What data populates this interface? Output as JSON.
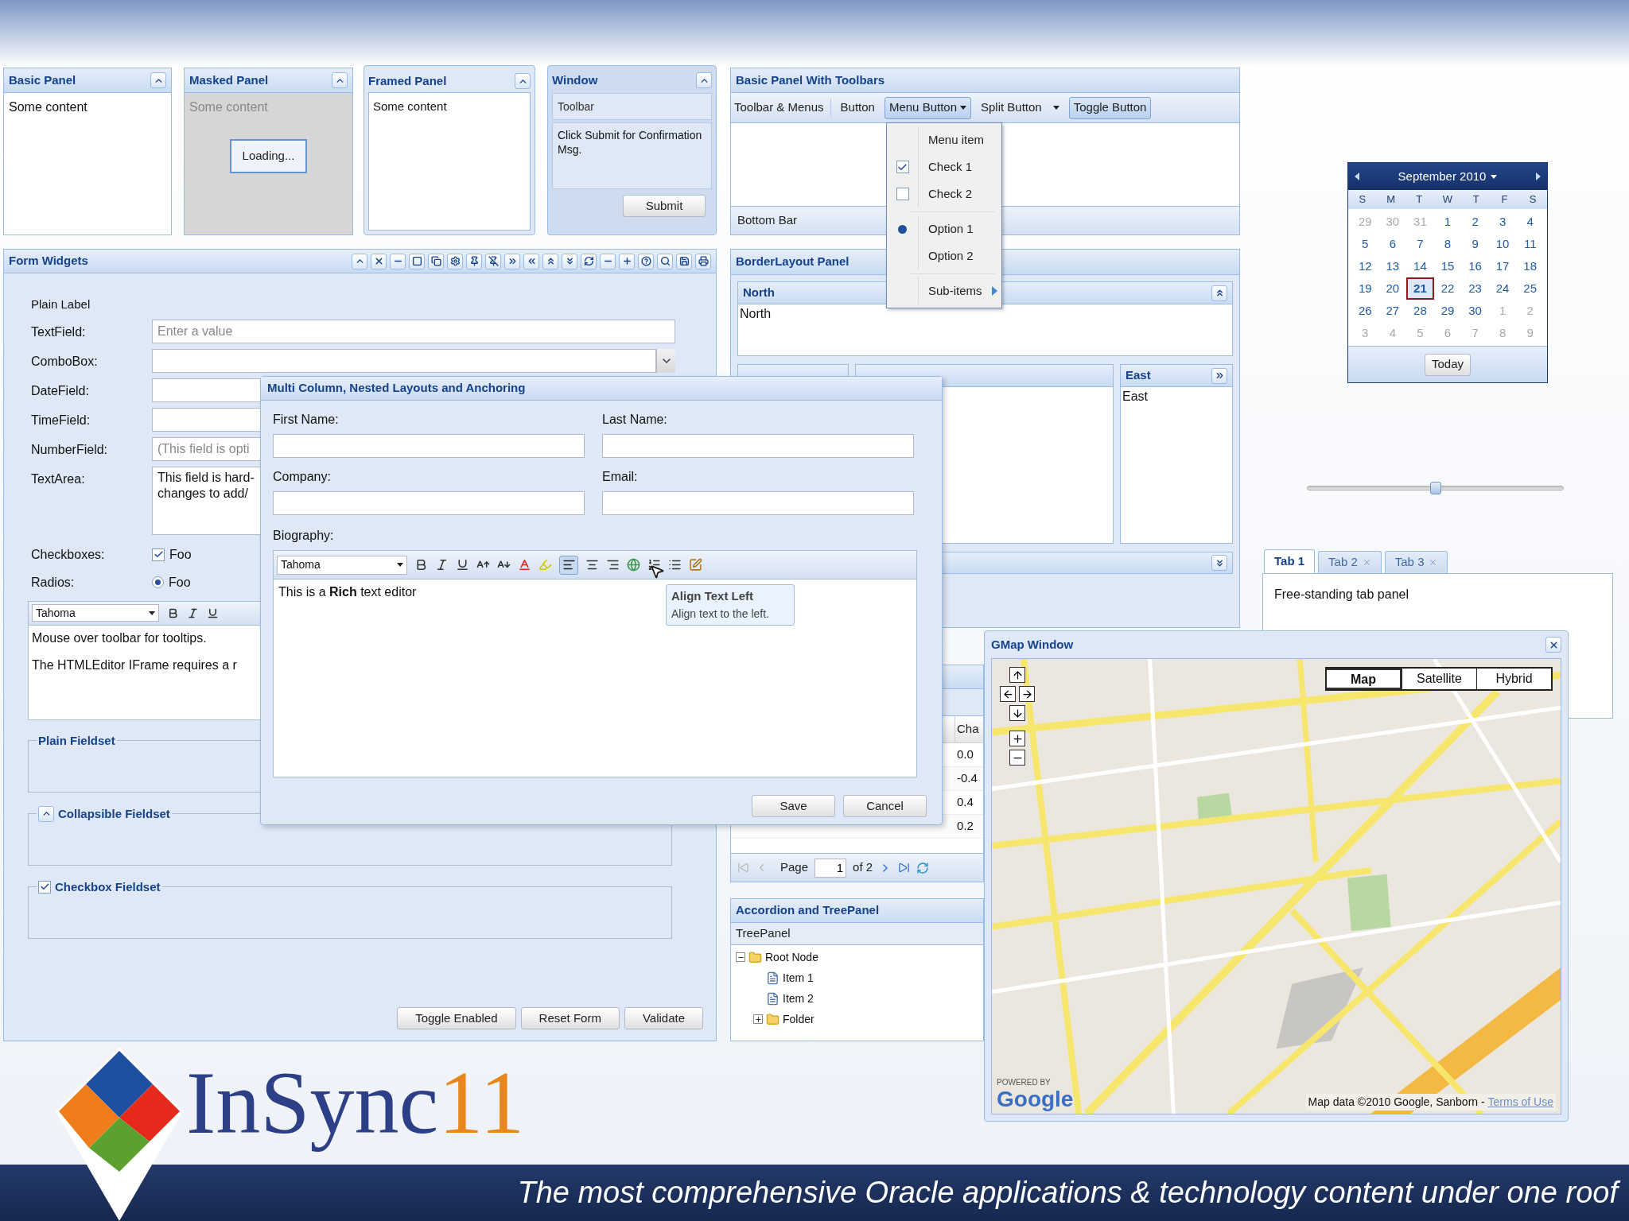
{
  "basic_panel": {
    "title": "Basic Panel",
    "content": "Some content"
  },
  "masked_panel": {
    "title": "Masked Panel",
    "content": "Some content",
    "masked": true,
    "mask_message": "Loading..."
  },
  "framed_panel": {
    "title": "Framed Panel",
    "content": "Some content"
  },
  "window_panel": {
    "title": "Window",
    "toolbar": "Toolbar",
    "content": "Click Submit for Confirmation Msg.",
    "button": "Submit"
  },
  "toolbar_panel": {
    "title": "Basic Panel With Toolbars",
    "toolbar": [
      {
        "kind": "text",
        "label": "Toolbar & Menus"
      },
      {
        "kind": "button",
        "label": "Button",
        "pressed": false
      },
      {
        "kind": "menu",
        "label": "Menu Button",
        "pressed": true
      },
      {
        "kind": "split",
        "label": "Split Button",
        "pressed": false
      },
      {
        "kind": "button",
        "label": "Toggle Button",
        "pressed": true
      }
    ],
    "bottom_bar": "Bottom Bar"
  },
  "menu": {
    "items": [
      {
        "kind": "item",
        "label": "Menu item"
      },
      {
        "kind": "check",
        "label": "Check 1",
        "checked": true
      },
      {
        "kind": "check",
        "label": "Check 2",
        "checked": false
      },
      {
        "kind": "separator"
      },
      {
        "kind": "radio",
        "label": "Option 1",
        "selected": true
      },
      {
        "kind": "radio",
        "label": "Option 2",
        "selected": false
      },
      {
        "kind": "separator"
      },
      {
        "kind": "submenu",
        "label": "Sub-items"
      }
    ]
  },
  "calendar": {
    "month": "September 2010",
    "weekdays": [
      "S",
      "M",
      "T",
      "W",
      "T",
      "F",
      "S"
    ],
    "days": [
      {
        "label": "29",
        "other_month": true,
        "selected": false
      },
      {
        "label": "30",
        "other_month": true,
        "selected": false
      },
      {
        "label": "31",
        "other_month": true,
        "selected": false
      },
      {
        "label": "1",
        "other_month": false,
        "selected": false
      },
      {
        "label": "2",
        "other_month": false,
        "selected": false
      },
      {
        "label": "3",
        "other_month": false,
        "selected": false
      },
      {
        "label": "4",
        "other_month": false,
        "selected": false
      },
      {
        "label": "5",
        "other_month": false,
        "selected": false
      },
      {
        "label": "6",
        "other_month": false,
        "selected": false
      },
      {
        "label": "7",
        "other_month": false,
        "selected": false
      },
      {
        "label": "8",
        "other_month": false,
        "selected": false
      },
      {
        "label": "9",
        "other_month": false,
        "selected": false
      },
      {
        "label": "10",
        "other_month": false,
        "selected": false
      },
      {
        "label": "11",
        "other_month": false,
        "selected": false
      },
      {
        "label": "12",
        "other_month": false,
        "selected": false
      },
      {
        "label": "13",
        "other_month": false,
        "selected": false
      },
      {
        "label": "14",
        "other_month": false,
        "selected": false
      },
      {
        "label": "15",
        "other_month": false,
        "selected": false
      },
      {
        "label": "16",
        "other_month": false,
        "selected": false
      },
      {
        "label": "17",
        "other_month": false,
        "selected": false
      },
      {
        "label": "18",
        "other_month": false,
        "selected": false
      },
      {
        "label": "19",
        "other_month": false,
        "selected": false
      },
      {
        "label": "20",
        "other_month": false,
        "selected": false
      },
      {
        "label": "21",
        "other_month": false,
        "selected": true
      },
      {
        "label": "22",
        "other_month": false,
        "selected": false
      },
      {
        "label": "23",
        "other_month": false,
        "selected": false
      },
      {
        "label": "24",
        "other_month": false,
        "selected": false
      },
      {
        "label": "25",
        "other_month": false,
        "selected": false
      },
      {
        "label": "26",
        "other_month": false,
        "selected": false
      },
      {
        "label": "27",
        "other_month": false,
        "selected": false
      },
      {
        "label": "28",
        "other_month": false,
        "selected": false
      },
      {
        "label": "29",
        "other_month": false,
        "selected": false
      },
      {
        "label": "30",
        "other_month": false,
        "selected": false
      },
      {
        "label": "1",
        "other_month": true,
        "selected": false
      },
      {
        "label": "2",
        "other_month": true,
        "selected": false
      },
      {
        "label": "3",
        "other_month": true,
        "selected": false
      },
      {
        "label": "4",
        "other_month": true,
        "selected": false
      },
      {
        "label": "5",
        "other_month": true,
        "selected": false
      },
      {
        "label": "6",
        "other_month": true,
        "selected": false
      },
      {
        "label": "7",
        "other_month": true,
        "selected": false
      },
      {
        "label": "8",
        "other_month": true,
        "selected": false
      },
      {
        "label": "9",
        "other_month": true,
        "selected": false
      }
    ],
    "today_button": "Today"
  },
  "slider": {
    "level": 0.5
  },
  "tab_panel": {
    "tabs": [
      {
        "label": "Tab 1",
        "selected": true,
        "closable": false
      },
      {
        "label": "Tab 2",
        "selected": false,
        "closable": true
      },
      {
        "label": "Tab 3",
        "selected": false,
        "closable": true
      }
    ],
    "content": "Free-standing tab panel"
  },
  "form_widgets": {
    "title": "Form Widgets",
    "plain_label": "Plain Label",
    "fields": [
      {
        "kind": "text",
        "label": "TextField:",
        "placeholder": "Enter a value"
      },
      {
        "kind": "combo",
        "label": "ComboBox:"
      },
      {
        "kind": "date",
        "label": "DateField:"
      },
      {
        "kind": "time",
        "label": "TimeField:"
      },
      {
        "kind": "number",
        "label": "NumberField:",
        "placeholder": "(This field is opti"
      },
      {
        "kind": "textarea",
        "label": "TextArea:",
        "lines": [
          "This field is hard-",
          "changes to add/"
        ]
      }
    ],
    "checkboxes": {
      "label": "Checkboxes:",
      "option": "Foo",
      "checked": true
    },
    "radios": {
      "label": "Radios:",
      "option": "Foo",
      "selected": true
    },
    "html_editor": {
      "font": "Tahoma",
      "lines": [
        "Mouse over toolbar for tooltips.",
        "The HTMLEditor IFrame requires a r"
      ]
    },
    "fieldsets": [
      {
        "kind": "plain",
        "title": "Plain Fieldset"
      },
      {
        "kind": "collapsible",
        "title": "Collapsible Fieldset",
        "expanded": true
      },
      {
        "kind": "checkbox",
        "title": "Checkbox Fieldset",
        "checked": true
      }
    ],
    "buttons": [
      "Toggle Enabled",
      "Reset Form",
      "Validate"
    ]
  },
  "border_layout": {
    "title": "BorderLayout Panel",
    "north": {
      "title": "North",
      "content": "North"
    },
    "east": {
      "title": "East",
      "content": "East"
    }
  },
  "grid": {
    "column": "Cha",
    "cells": [
      "0.0",
      "-0.4",
      "0.4",
      "0.2"
    ],
    "paging": {
      "page_label": "Page",
      "page": "1",
      "of": "of 2"
    }
  },
  "accordion": {
    "title": "Accordion and TreePanel",
    "section": "TreePanel",
    "tree": [
      {
        "label": "Root Node",
        "kind": "folder",
        "expanded": true,
        "children": [
          {
            "label": "Item 1",
            "kind": "leaf"
          },
          {
            "label": "Item 2",
            "kind": "leaf"
          },
          {
            "label": "Folder",
            "kind": "folder",
            "expanded": false
          }
        ]
      }
    ]
  },
  "dialog": {
    "title": "Multi Column, Nested Layouts and Anchoring",
    "fields": [
      {
        "label": "First Name:"
      },
      {
        "label": "Last Name:"
      },
      {
        "label": "Company:"
      },
      {
        "label": "Email:"
      }
    ],
    "biography_label": "Biography:",
    "editor_font": "Tahoma",
    "editor_text": "This is a **Rich** text editor",
    "tooltip": {
      "title": "Align Text Left",
      "text": "Align text to the left."
    },
    "buttons": [
      "Save",
      "Cancel"
    ]
  },
  "gmap": {
    "title": "GMap Window",
    "map_types": [
      {
        "label": "Map",
        "selected": true
      },
      {
        "label": "Satellite",
        "selected": false
      },
      {
        "label": "Hybrid",
        "selected": false
      }
    ],
    "powered_by": "POWERED BY",
    "logo": "Google",
    "attribution": "Map data ©2010 Google, Sanborn - ",
    "terms_link": "Terms of Use"
  },
  "branding": {
    "logo_text": "InSync",
    "logo_number": "11",
    "tagline": "The most comprehensive Oracle applications & technology content under one roof"
  }
}
